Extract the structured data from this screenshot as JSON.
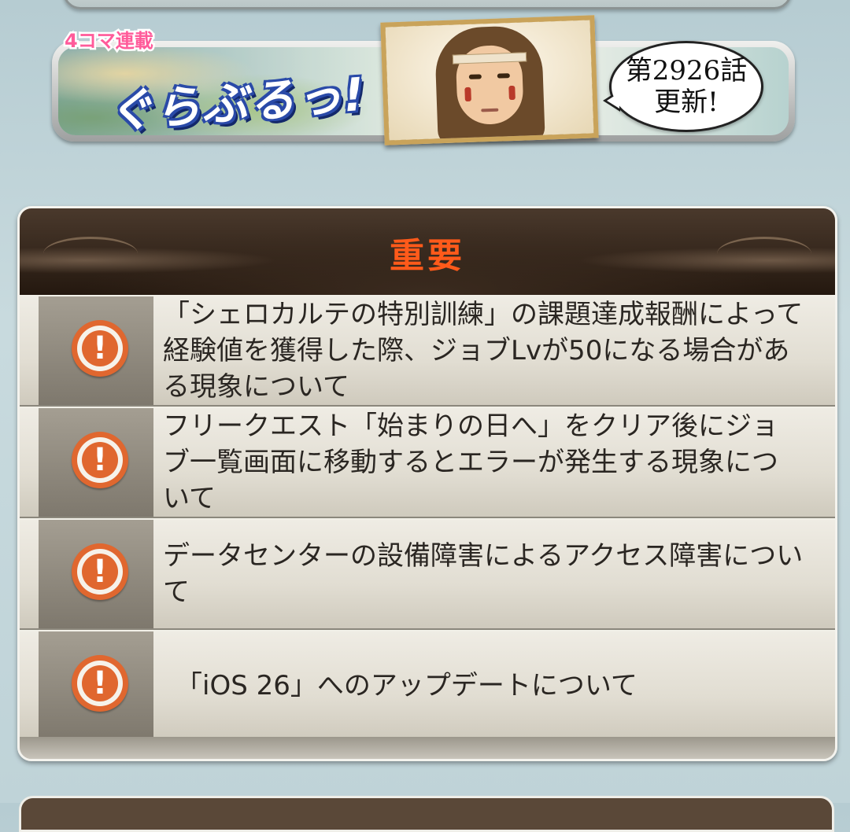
{
  "banner": {
    "badge": "4コマ連載",
    "title": "ぐらぶるっ!",
    "bubble_line1": "第2926話",
    "bubble_line2": "更新!"
  },
  "news_panel": {
    "title": "重要",
    "items": [
      {
        "icon": "exclamation-circle-icon",
        "text": "「シェロカルテの特別訓練」の課題達成報酬によって経験値を獲得した際、ジョブLvが50になる場合がある現象について"
      },
      {
        "icon": "exclamation-circle-icon",
        "text": "フリークエスト「始まりの日へ」をクリア後にジョブ一覧画面に移動するとエラーが発生する現象について"
      },
      {
        "icon": "exclamation-circle-icon",
        "text": "データセンターの設備障害によるアクセス障害について"
      },
      {
        "icon": "exclamation-circle-icon",
        "text": "「iOS 26」へのアップデートについて"
      }
    ]
  },
  "colors": {
    "title_accent": "#ff5a1a",
    "icon_accent": "#e0672f",
    "badge_pink": "#ff5b9a"
  }
}
